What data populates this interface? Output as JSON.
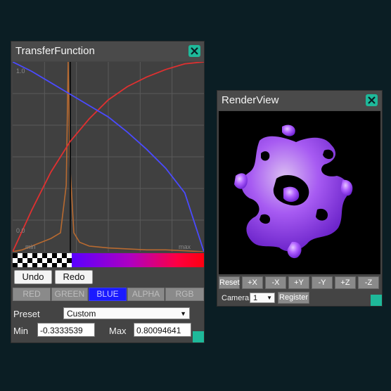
{
  "transfer_function": {
    "title": "TransferFunction",
    "graph": {
      "y_max_label": "1.0",
      "y_min_label": "0.0",
      "x_min_label": "min",
      "x_max_label": "max"
    },
    "undo_label": "Undo",
    "redo_label": "Redo",
    "channels": [
      "RED",
      "GREEN",
      "BLUE",
      "ALPHA",
      "RGB"
    ],
    "active_channel": "BLUE",
    "preset_label": "Preset",
    "preset_value": "Custom",
    "min_label": "Min",
    "min_value": "-0.3333539",
    "max_label": "Max",
    "max_value": "0.80094641"
  },
  "render_view": {
    "title": "RenderView",
    "buttons": {
      "reset": "Reset",
      "plus_x": "+X",
      "minus_x": "-X",
      "plus_y": "+Y",
      "minus_y": "-Y",
      "plus_z": "+Z",
      "minus_z": "-Z"
    },
    "camera_label": "Camera:",
    "camera_value": "1",
    "register_label": "Register"
  },
  "colors": {
    "accent": "#1eb99a",
    "active_channel": "#1a1aff",
    "red_curve": "#e03030",
    "blue_curve": "#4a4aff",
    "histogram": "#b86a30",
    "volume": "#a855ff"
  },
  "chart_data": {
    "type": "line",
    "xlim": [
      0,
      1
    ],
    "ylim": [
      0,
      1
    ],
    "grid": true,
    "series": [
      {
        "x": [
          0,
          0.1,
          0.2,
          0.3,
          0.4,
          0.5,
          0.6,
          0.7,
          0.8,
          0.9,
          1.0
        ],
        "values": [
          0.0,
          0.22,
          0.42,
          0.58,
          0.7,
          0.8,
          0.87,
          0.92,
          0.96,
          0.99,
          1.0
        ]
      },
      {
        "x": [
          0,
          0.1,
          0.2,
          0.3,
          0.4,
          0.5,
          0.6,
          0.7,
          0.8,
          0.9,
          1.0
        ],
        "values": [
          1.0,
          0.95,
          0.89,
          0.83,
          0.77,
          0.71,
          0.63,
          0.54,
          0.44,
          0.31,
          0.0
        ]
      },
      {
        "x": [
          0,
          0.05,
          0.1,
          0.15,
          0.2,
          0.25,
          0.28,
          0.29,
          0.3,
          0.32,
          0.35,
          0.4,
          0.5,
          0.6,
          0.7,
          0.8,
          0.9,
          1.0
        ],
        "values": [
          0.0,
          0.01,
          0.03,
          0.05,
          0.07,
          0.1,
          0.35,
          1.0,
          0.45,
          0.1,
          0.05,
          0.03,
          0.02,
          0.015,
          0.01,
          0.01,
          0.005,
          0.0
        ]
      }
    ]
  }
}
